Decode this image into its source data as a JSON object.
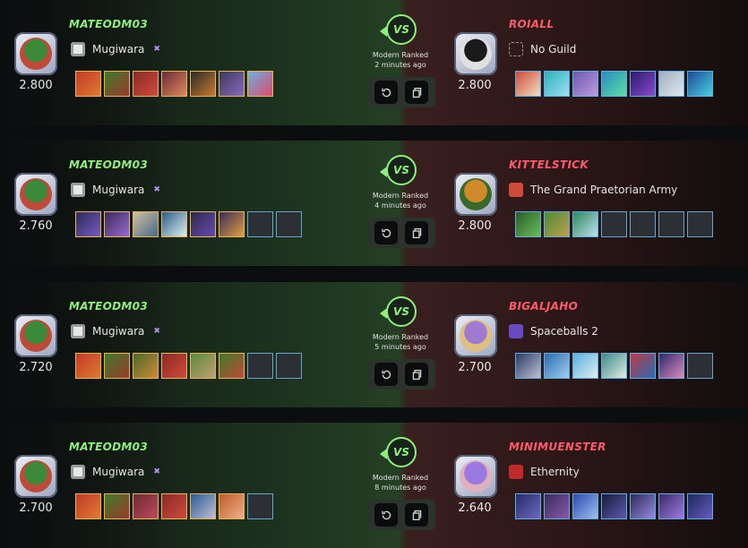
{
  "battles": [
    {
      "left": {
        "name": "MATEODM03",
        "guild": "Mugiwara",
        "rating": "2.800",
        "cards": [
          {
            "c1": "#c23a2a",
            "c2": "#e07a30"
          },
          {
            "c1": "#3e7a2a",
            "c2": "#9a3a2a"
          },
          {
            "c1": "#8a2a2a",
            "c2": "#d04a3a"
          },
          {
            "c1": "#6a2a3a",
            "c2": "#e08a5a"
          },
          {
            "c1": "#2a2a2a",
            "c2": "#c87a2a"
          },
          {
            "c1": "#3a3a5a",
            "c2": "#8a6ac0"
          },
          {
            "c1": "#6ab0e0",
            "c2": "#e04a6a"
          }
        ]
      },
      "right": {
        "name": "ROIALL",
        "guild": "No Guild",
        "rating": "2.800",
        "cards": [
          {
            "c1": "#d04a3a",
            "c2": "#f0e0c0",
            "blue": true
          },
          {
            "c1": "#2ab0c0",
            "c2": "#a0e0f0",
            "blue": true
          },
          {
            "c1": "#6a5ab0",
            "c2": "#c09ae0",
            "blue": true
          },
          {
            "c1": "#2a8ac0",
            "c2": "#5ae0a0",
            "blue": true
          },
          {
            "c1": "#2a1a6a",
            "c2": "#8a4ad0",
            "blue": true
          },
          {
            "c1": "#a0b0c0",
            "c2": "#e0e8f0",
            "blue": true
          },
          {
            "c1": "#1a4a9a",
            "c2": "#4ad0e0",
            "blue": true
          }
        ]
      },
      "mode": "Modern Ranked",
      "time": "2 minutes ago"
    },
    {
      "left": {
        "name": "MATEODM03",
        "guild": "Mugiwara",
        "rating": "2.760",
        "cards": [
          {
            "c1": "#2a2a5a",
            "c2": "#7a5ac0"
          },
          {
            "c1": "#3a2a5a",
            "c2": "#9a6ad0"
          },
          {
            "c1": "#d0c0a0",
            "c2": "#4a6a8a"
          },
          {
            "c1": "#2a5a8a",
            "c2": "#e0f0f0"
          },
          {
            "c1": "#2a2a4a",
            "c2": "#6a4ab0"
          },
          {
            "c1": "#3a2a5a",
            "c2": "#e0a040"
          },
          {
            "empty": true
          },
          {
            "empty": true
          }
        ]
      },
      "right": {
        "name": "KITTELSTICK",
        "guild": "The Grand Praetorian Army",
        "rating": "2.800",
        "cards": [
          {
            "c1": "#2a5a2a",
            "c2": "#6ac05a",
            "blue": true
          },
          {
            "c1": "#4a8a3a",
            "c2": "#c0a04a",
            "blue": true
          },
          {
            "c1": "#2a8a5a",
            "c2": "#c0e0f0",
            "blue": true
          },
          {
            "empty": true
          },
          {
            "empty": true
          },
          {
            "empty": true
          },
          {
            "empty": true
          }
        ]
      },
      "mode": "Modern Ranked",
      "time": "4 minutes ago"
    },
    {
      "left": {
        "name": "MATEODM03",
        "guild": "Mugiwara",
        "rating": "2.720",
        "cards": [
          {
            "c1": "#c23a2a",
            "c2": "#e07a30"
          },
          {
            "c1": "#3e7a2a",
            "c2": "#9a3a2a"
          },
          {
            "c1": "#4a6a2a",
            "c2": "#d08a3a"
          },
          {
            "c1": "#8a2a2a",
            "c2": "#d04a3a"
          },
          {
            "c1": "#5a8a3a",
            "c2": "#c0a070"
          },
          {
            "c1": "#3e7a2a",
            "c2": "#c04a3a"
          },
          {
            "empty": true
          },
          {
            "empty": true
          }
        ]
      },
      "right": {
        "name": "BIGALJAHO",
        "guild": "Spaceballs 2",
        "rating": "2.700",
        "cards": [
          {
            "c1": "#2a3a6a",
            "c2": "#c0c0d0",
            "blue": true
          },
          {
            "c1": "#2a6ab0",
            "c2": "#a0d0f0",
            "blue": true
          },
          {
            "c1": "#5ab0e0",
            "c2": "#e0f0f0",
            "blue": true
          },
          {
            "c1": "#3a8a8a",
            "c2": "#e0f0e0",
            "blue": true
          },
          {
            "c1": "#c03a4a",
            "c2": "#2a6ab0",
            "blue": true
          },
          {
            "c1": "#2a2a6a",
            "c2": "#e08ac0",
            "blue": true
          },
          {
            "empty": true
          }
        ]
      },
      "mode": "Modern Ranked",
      "time": "5 minutes ago"
    },
    {
      "left": {
        "name": "MATEODM03",
        "guild": "Mugiwara",
        "rating": "2.700",
        "cards": [
          {
            "c1": "#c23a2a",
            "c2": "#e07a30"
          },
          {
            "c1": "#3e7a2a",
            "c2": "#9a3a2a"
          },
          {
            "c1": "#6a2a3a",
            "c2": "#c04a5a"
          },
          {
            "c1": "#8a2a2a",
            "c2": "#d04a3a"
          },
          {
            "c1": "#2a5a9a",
            "c2": "#c0c0d0"
          },
          {
            "c1": "#c05a2a",
            "c2": "#f0b08a"
          },
          {
            "empty": true
          }
        ]
      },
      "right": {
        "name": "MINIMUENSTER",
        "guild": "Ethernity",
        "rating": "2.640",
        "cards": [
          {
            "c1": "#2a2a6a",
            "c2": "#6a6ac0",
            "blue": true
          },
          {
            "c1": "#3a2a5a",
            "c2": "#8a5ab0",
            "blue": true
          },
          {
            "c1": "#2a4ab0",
            "c2": "#a0c0f0",
            "blue": true
          },
          {
            "c1": "#1a1a3a",
            "c2": "#5a5ab0",
            "blue": true
          },
          {
            "c1": "#2a2a5a",
            "c2": "#9a8ae0",
            "blue": true
          },
          {
            "c1": "#3a2a6a",
            "c2": "#a07ae0",
            "blue": true
          },
          {
            "c1": "#1a2a5a",
            "c2": "#6a5ac0",
            "blue": true
          }
        ]
      },
      "mode": "Modern Ranked",
      "time": "8 minutes ago"
    }
  ],
  "vs_label": "VS",
  "guild_mark": "✖",
  "icons": {
    "replay": "replay-icon",
    "copy": "copy-icon"
  },
  "colors": {
    "winner": "#8ef07a",
    "loser": "#ff5a6a",
    "card_gold": "#e8b64a",
    "card_blue": "#5ab0e6"
  }
}
